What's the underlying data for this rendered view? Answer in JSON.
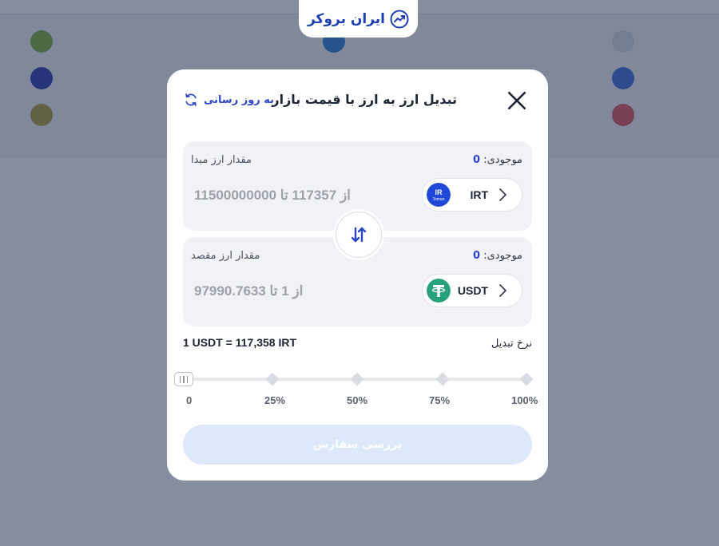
{
  "brand": {
    "logo_text": "ایران بروکر"
  },
  "modal": {
    "title": "تبدیل ارز به ارز با قیمت بازار",
    "refresh_label": "به روز رسانی",
    "from": {
      "balance_label": "موجودی:",
      "balance_value": "0",
      "amount_label": "مقدار ارز مبدا",
      "coin_code": "IRT",
      "coin_logo_text": "IR",
      "coin_logo_subtext": "Toman",
      "range_text": "از 117357 تا 11500000000"
    },
    "to": {
      "balance_label": "موجودی:",
      "balance_value": "0",
      "amount_label": "مقدار ارز مقصد",
      "coin_code": "USDT",
      "range_text": "از 1 تا 97990.7633"
    },
    "rate_label": "نرخ تبدیل",
    "rate_value": "1 USDT = 117,358 IRT",
    "slider": {
      "value_percent": 0,
      "labels": [
        "0",
        "25%",
        "50%",
        "75%",
        "100%"
      ]
    },
    "submit_label": "بررسی سفارش"
  },
  "colors": {
    "accent": "#2b47c8",
    "tether": "#26a17b",
    "toman": "#2048d8",
    "submit_disabled": "#dde8fb"
  },
  "icons": {
    "close": "close-icon",
    "refresh": "refresh-icon",
    "swap": "swap-arrows-icon",
    "chevron": "chevron-left-icon"
  }
}
